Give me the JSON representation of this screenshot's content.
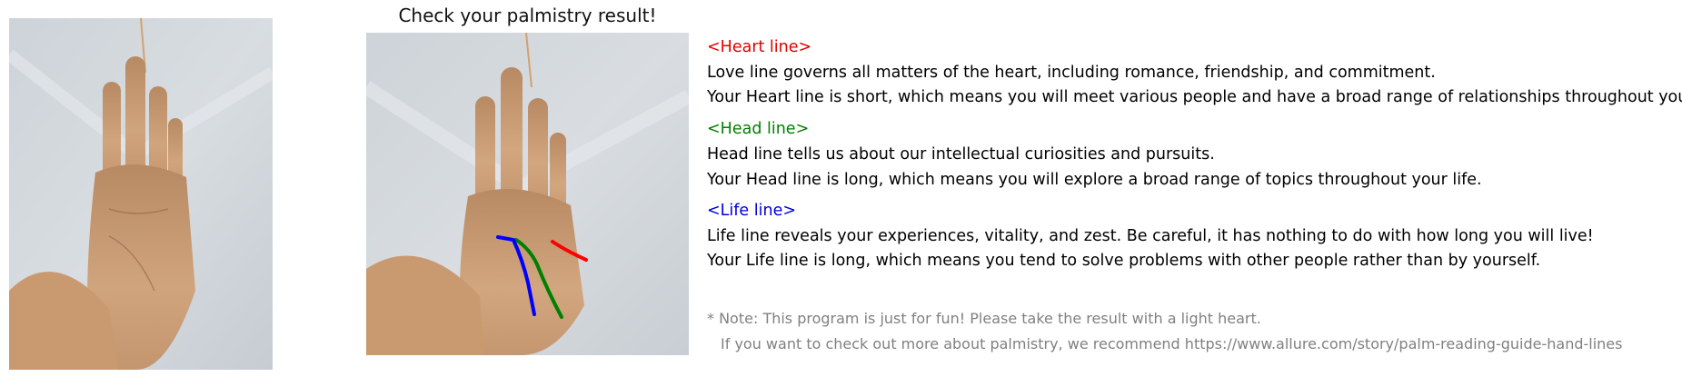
{
  "result_title": "Check your palmistry result!",
  "sections": {
    "heart": {
      "heading": "<Heart line>",
      "color": "#e00000",
      "description": "Love line governs all matters of the heart, including romance, friendship, and commitment.",
      "result": "Your Heart line is short, which means you will meet various people and have a broad range of relationships throughout your life."
    },
    "head": {
      "heading": "<Head line>",
      "color": "#008000",
      "description": "Head line tells us about our intellectual curiosities and pursuits.",
      "result": "Your Head line is long, which means you will explore a broad range of topics throughout your life."
    },
    "life": {
      "heading": "<Life line>",
      "color": "#0000e0",
      "description": "Life line reveals your experiences, vitality, and zest. Be careful, it has nothing to do with how long you will live!",
      "result": "Your Life line is long, which means you tend to solve problems with other people rather than by yourself."
    }
  },
  "note": {
    "line1": "* Note: This program is just for fun! Please take the result with a light heart.",
    "line2": "If you want to check out more about palmistry, we recommend https://www.allure.com/story/palm-reading-guide-hand-lines"
  },
  "palm_line_colors": {
    "heart": "#ff0000",
    "head": "#008000",
    "life": "#0000ff"
  }
}
